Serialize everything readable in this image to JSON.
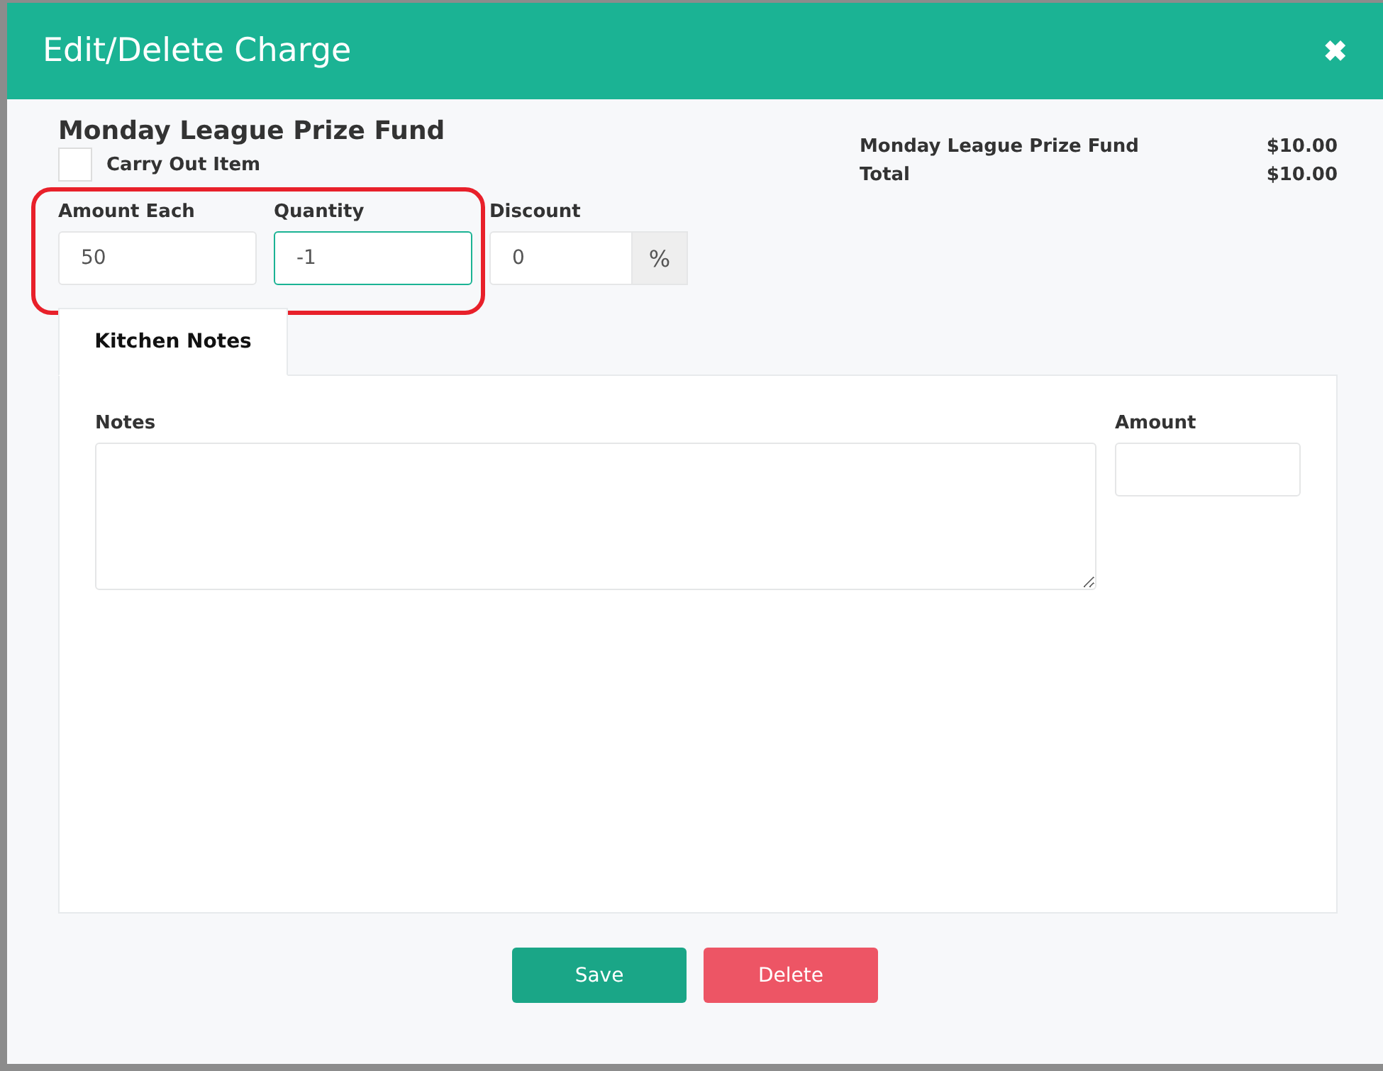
{
  "dialog": {
    "title": "Edit/Delete Charge",
    "close": "✖"
  },
  "item_title": "Monday League Prize Fund",
  "carry_out": {
    "label": "Carry Out Item",
    "checked": false
  },
  "fields": [
    {
      "kind": "plain",
      "label": "Amount Each",
      "value": "50",
      "focused": false
    },
    {
      "kind": "plain",
      "label": "Quantity",
      "value": "-1",
      "focused": true
    },
    {
      "kind": "percent",
      "label": "Discount",
      "value": "0",
      "addon": "%",
      "focused": false
    }
  ],
  "summary": [
    {
      "label": "Monday League Prize Fund",
      "amount": "$10.00"
    },
    {
      "label": "Total",
      "amount": "$10.00"
    }
  ],
  "tabs": [
    {
      "label": "Kitchen Notes",
      "selected": true
    }
  ],
  "notes": {
    "label": "Notes"
  },
  "amount": {
    "label": "Amount"
  },
  "buttons": [
    {
      "kind": "save",
      "label": "Save"
    },
    {
      "kind": "delete",
      "label": "Delete"
    }
  ]
}
